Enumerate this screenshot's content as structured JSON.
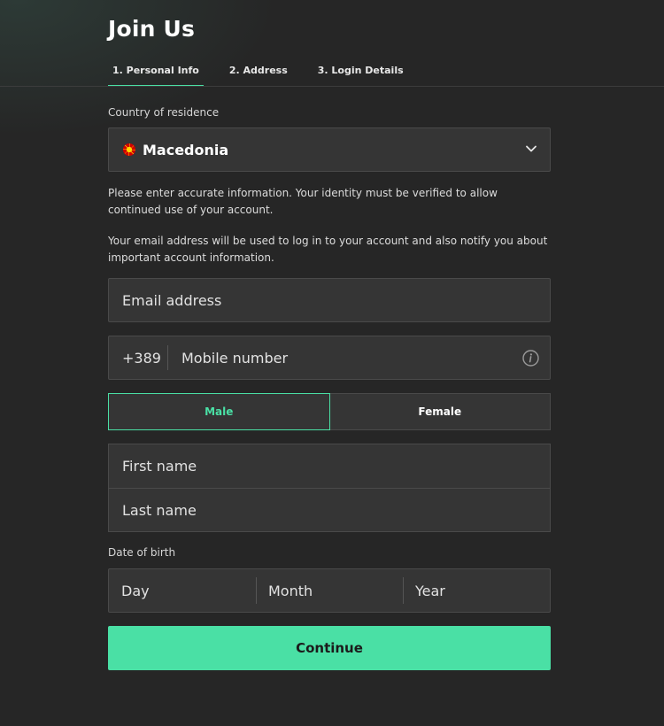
{
  "header": {
    "title": "Join Us"
  },
  "tabs": [
    {
      "label": "1. Personal Info",
      "active": true
    },
    {
      "label": "2. Address",
      "active": false
    },
    {
      "label": "3. Login Details",
      "active": false
    }
  ],
  "country": {
    "label": "Country of residence",
    "value": "Macedonia",
    "flag_icon": "macedonia-flag-icon"
  },
  "info_text_1": "Please enter accurate information. Your identity must be verified to allow continued use of your account.",
  "info_text_2": "Your email address will be used to log in to your account and also notify you about important account information.",
  "email": {
    "placeholder": "Email address",
    "value": ""
  },
  "mobile": {
    "prefix": "+389",
    "placeholder": "Mobile number",
    "value": ""
  },
  "gender": {
    "male_label": "Male",
    "female_label": "Female",
    "selected": "Male"
  },
  "names": {
    "first_placeholder": "First name",
    "last_placeholder": "Last name"
  },
  "dob": {
    "label": "Date of birth",
    "day_placeholder": "Day",
    "month_placeholder": "Month",
    "year_placeholder": "Year"
  },
  "continue_label": "Continue",
  "colors": {
    "accent": "#4ae0a5",
    "background": "#262626",
    "field": "#353535"
  }
}
